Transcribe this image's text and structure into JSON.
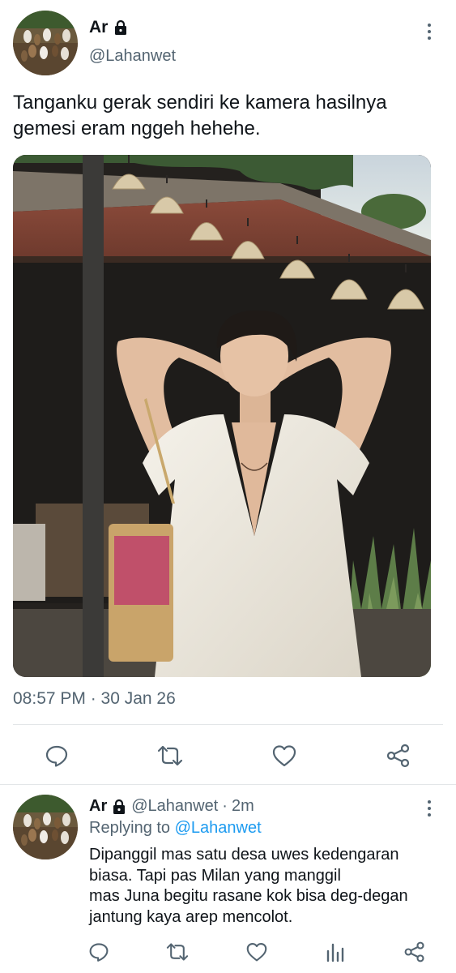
{
  "main_tweet": {
    "display_name": "Ar",
    "handle": "@Lahanwet",
    "text": "Tanganku gerak sendiri ke kamera hasilnya\ngemesi eram nggeh hehehe.",
    "timestamp": "08:57 PM · 30 Jan 26",
    "actions": [
      {
        "icon": "reply-icon"
      },
      {
        "icon": "retweet-icon"
      },
      {
        "icon": "like-icon"
      },
      {
        "icon": "share-icon"
      }
    ]
  },
  "reply_tweet": {
    "display_name": "Ar",
    "handle": "@Lahanwet",
    "separator": "·",
    "time": "2m",
    "replying_prefix": "Replying to",
    "replying_to": "@Lahanwet",
    "text": "Dipanggil mas satu desa uwes kedengaran\nbiasa. Tapi pas Milan yang manggil\nmas Juna begitu rasane kok bisa deg-degan\njantung kaya arep mencolot.",
    "actions": [
      {
        "icon": "reply-icon"
      },
      {
        "icon": "retweet-icon"
      },
      {
        "icon": "like-icon"
      },
      {
        "icon": "views-icon"
      },
      {
        "icon": "share-icon"
      }
    ]
  },
  "colors": {
    "text_primary": "#0f1419",
    "text_secondary": "#536471",
    "link": "#1d9bf0",
    "divider": "#e3e6e8"
  }
}
